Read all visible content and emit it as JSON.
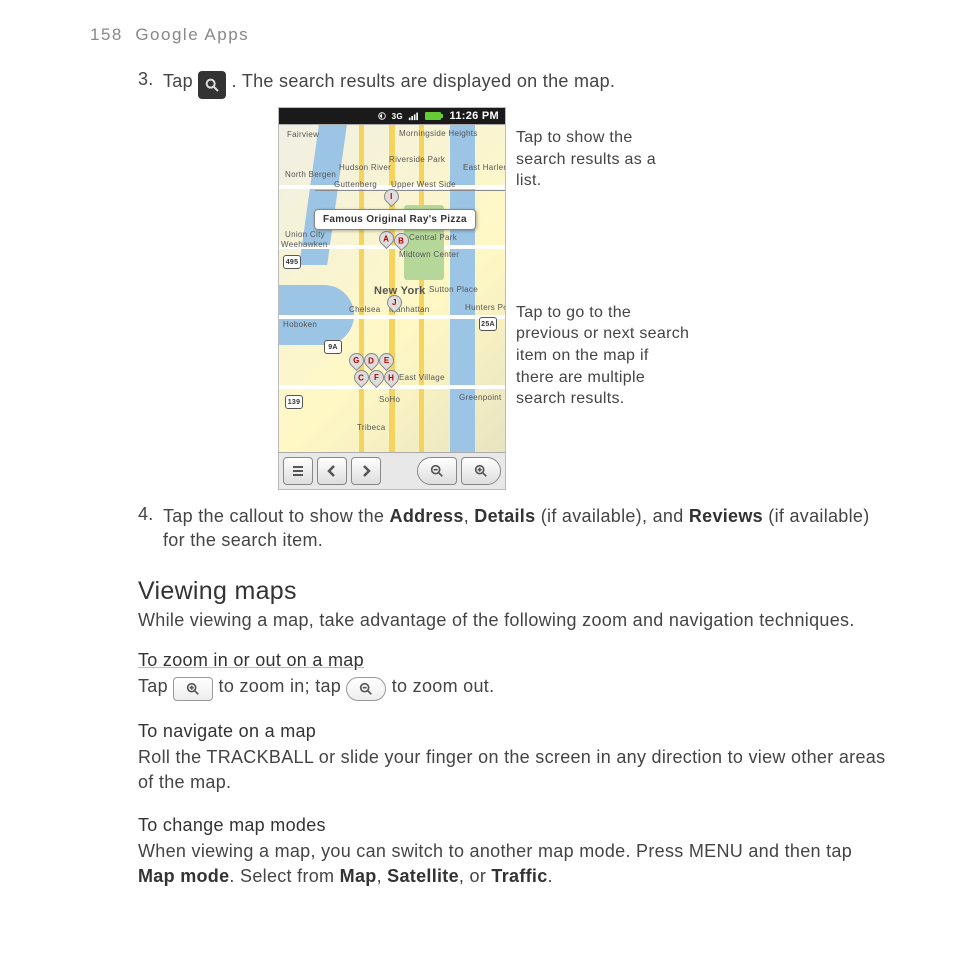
{
  "header": {
    "page_number": "158",
    "section": "Google Apps"
  },
  "step3": {
    "number": "3.",
    "pre": "Tap ",
    "post": ". The search results are displayed on the map."
  },
  "phone": {
    "time": "11:26 PM",
    "callout_label": "Famous Original Ray's Pizza",
    "labels": {
      "fairview": "Fairview",
      "nbergen": "North Bergen",
      "guttenberg": "Guttenberg",
      "uws": "Upper West Side",
      "morningside": "Morningside Heights",
      "riverside": "Riverside Park",
      "hudsonr": "Hudson River",
      "eastharlem": "East Harlem",
      "unioncity": "Union City",
      "weehawken": "Weehawken",
      "centralpark": "Central Park",
      "midtown": "Midtown Center",
      "newyork": "New York",
      "suttonplace": "Sutton Place",
      "hunterspt": "Hunters Point",
      "chelsea": "Chelsea",
      "manhattan": "Manhattan",
      "hoboken": "Hoboken",
      "eastvillage": "East Village",
      "greenpoint": "Greenpoint",
      "tribeca": "Tribeca",
      "soho": "SoHo"
    },
    "pins": {
      "a": "A",
      "b": "B",
      "c": "C",
      "d": "D",
      "e": "E",
      "f": "F",
      "g": "G",
      "h": "H",
      "i": "I",
      "j": "J"
    },
    "shields": {
      "r495": "495",
      "r9a": "9A",
      "r25a": "25A",
      "r139": "139"
    }
  },
  "annot": {
    "a1": "Tap to show the search results as a list.",
    "a2": "Tap to go to the previous or next search item on the map if there are multiple search results."
  },
  "step4": {
    "number": "4.",
    "text_pre": "Tap the callout to show the ",
    "b1": "Address",
    "mid1": ", ",
    "b2": "Details",
    "mid2": " (if available), and ",
    "b3": "Reviews",
    "post": " (if available) for the search item."
  },
  "viewing": {
    "heading": "Viewing maps",
    "lead": "While viewing a map, take advantage of the following zoom and navigation techniques."
  },
  "zoom": {
    "title": "To zoom in or out on a map",
    "pre": "Tap ",
    "mid": " to zoom in; tap ",
    "post": " to zoom out."
  },
  "navigate": {
    "title": "To navigate on a map",
    "body": "Roll the TRACKBALL or slide your finger on the screen in any direction to view other areas of the map."
  },
  "modes": {
    "title": "To change map modes",
    "pre": "When viewing a map, you can switch to another map mode. Press MENU and then tap ",
    "b1": "Map mode",
    "mid1": ". Select from ",
    "b2": "Map",
    "mid2": ", ",
    "b3": "Satellite",
    "mid3": ", or ",
    "b4": "Traffic",
    "post": "."
  }
}
